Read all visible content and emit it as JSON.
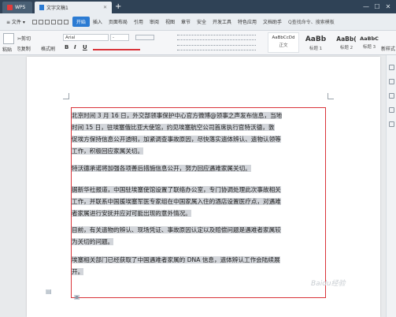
{
  "titlebar": {
    "app_tab": "WPS",
    "doc_tab": "文字文稿1",
    "new_tab": "+",
    "win_controls": [
      "—",
      "☐",
      "✕"
    ]
  },
  "menubar": {
    "file": "≡ 文件 ▾",
    "items": [
      "开始",
      "插入",
      "页面布局",
      "引用",
      "审阅",
      "视图",
      "章节",
      "安全",
      "开发工具",
      "特色应用",
      "文档助手"
    ],
    "active_item": "开始",
    "search": "Q查找命令、搜索模板",
    "right_label": "文档助手"
  },
  "ribbon": {
    "paste": "粘贴",
    "cut": "✂剪切",
    "copy": "⎘复制",
    "format_painter": "格式刷",
    "font_name": "Arial",
    "font_size": "-",
    "bold": "B",
    "italic": "I",
    "underline": "U",
    "styles": [
      {
        "sample": "AaBbCcDd",
        "name": "正文"
      },
      {
        "sample": "AaBb",
        "name": "标题 1"
      },
      {
        "sample": "AaBb(",
        "name": "标题 2"
      },
      {
        "sample": "AaBbC",
        "name": "标题 3"
      }
    ],
    "new_style": "新样式"
  },
  "document": {
    "paragraphs": [
      [
        "北京时间 3 月 16 日，外交部领事保护中心官方微博@领事之声发布信息，当地",
        "时间 15 日，驻埃塞俄比亚大使馆，约见埃塞航空公司首席执行官特沃德，敦",
        "促埃方保持信息公开透明，加紧调查事故原因，尽快落实遗体辨认、遗物认领等",
        "工作，积极回应家属关切。"
      ],
      [
        "特沃德承诺将加强各项善后措施信息公开，努力回应遇难家属关切。"
      ],
      [
        "据新华社报道，中国驻埃塞使馆设置了联络办公室，专门协调处理此次事故相关",
        "工作，并联系中国援埃塞军医专家组在中国家属入住的酒店设置医疗点，对遇难",
        "者家属进行安抚并应对可能出现的意外情况。"
      ],
      [
        "目前，有关遗物的辨认、现场凭证、事故原因认定以及赔偿问题是遇难者家属较",
        "为关切的问题。"
      ],
      [
        "埃塞相关部门已经获取了中国遇难者家属的 DNA 信息，遗体辨认工作会陆续展",
        "开。"
      ]
    ]
  },
  "watermark": "Baidu经验"
}
